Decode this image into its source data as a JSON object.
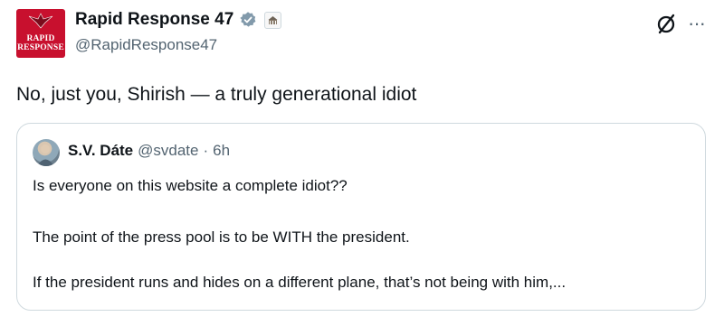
{
  "author": {
    "avatar_text": "RAPID\nRESPONSE",
    "display_name": "Rapid Response 47",
    "handle": "@RapidResponse47",
    "verified_color": "#829aab"
  },
  "tweet": {
    "text": "No, just you, Shirish — a truly generational idiot"
  },
  "quote": {
    "display_name": "S.V. Dáte",
    "handle": "@svdate",
    "separator": "·",
    "time": "6h",
    "lines": [
      "Is everyone on this website a complete idiot??",
      "The point of the press pool is to be WITH the president.",
      "If the president runs and hides on a different plane, that’s not being with him,..."
    ]
  },
  "icons": {
    "verified": "verified-badge-icon",
    "affiliation": "white-house-seal-icon",
    "grok": "grok-icon",
    "more": "more-options-icon"
  },
  "colors": {
    "brand_red": "#c8102e",
    "text": "#0f1419",
    "secondary": "#536471",
    "border": "#cfd9de"
  }
}
